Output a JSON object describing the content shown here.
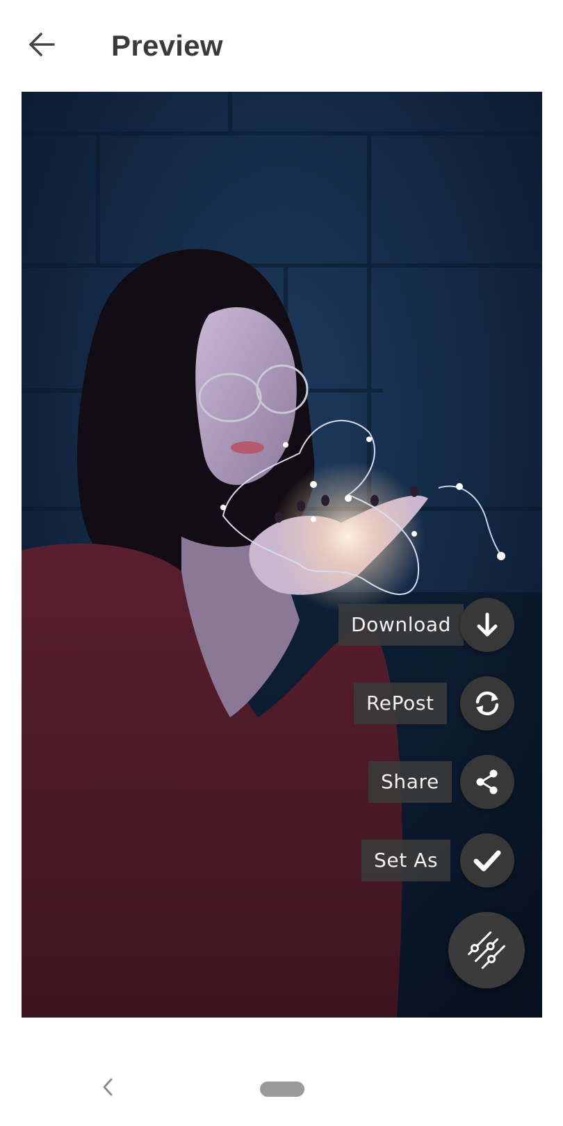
{
  "header": {
    "title": "Preview",
    "back_icon": "arrow-left-icon"
  },
  "photo": {
    "description_icon": "photo-preview"
  },
  "actions": [
    {
      "id": "download",
      "label": "Download",
      "icon": "arrow-down-icon"
    },
    {
      "id": "repost",
      "label": "RePost",
      "icon": "refresh-icon"
    },
    {
      "id": "share",
      "label": "Share",
      "icon": "share-icon"
    },
    {
      "id": "set-as",
      "label": "Set As",
      "icon": "check-icon"
    }
  ],
  "fab": {
    "icon": "sliders-icon"
  },
  "navbar": {
    "back_icon": "chevron-left-icon",
    "home_icon": "home-pill"
  },
  "colors": {
    "title_text": "#3a3a3a",
    "action_bg": "#383838",
    "label_bg": "#3a3a3a",
    "photo_bg": "#0a1a2e"
  }
}
